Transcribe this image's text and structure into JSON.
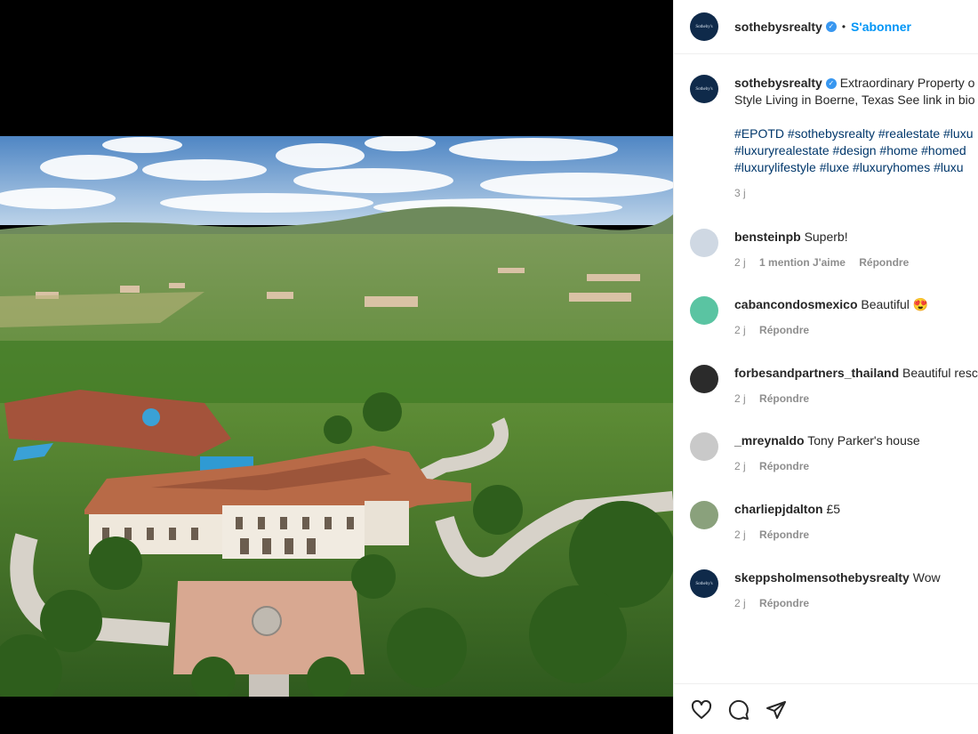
{
  "post": {
    "username": "sothebysrealty",
    "follow_label": "S'abonner",
    "separator": "•",
    "avatar_text": "Sotheby's"
  },
  "caption": {
    "username": "sothebysrealty",
    "line1": "Extraordinary Property o",
    "line2": "Style Living in Boerne, Texas See link in bio",
    "tags1": "#EPOTD #sothebysrealty #realestate #luxu",
    "tags2": "#luxuryrealestate #design #home #homed",
    "tags3": "#luxurylifestyle #luxe #luxuryhomes #luxu",
    "time": "3 j"
  },
  "comments": [
    {
      "user": "bensteinpb",
      "text": "Superb!",
      "time": "2 j",
      "likes": "1 mention J'aime",
      "reply": "Répondre"
    },
    {
      "user": "cabancondosmexico",
      "text": "Beautiful 😍",
      "time": "2 j",
      "reply": "Répondre"
    },
    {
      "user": "forbesandpartners_thailand",
      "text": "Beautiful resc",
      "time": "2 j",
      "reply": "Répondre"
    },
    {
      "user": "_mreynaldo",
      "text": "Tony Parker's house",
      "time": "2 j",
      "reply": "Répondre"
    },
    {
      "user": "charliepjdalton",
      "text": "£5",
      "time": "2 j",
      "reply": "Répondre"
    },
    {
      "user": "skeppsholmensothebysrealty",
      "text": "Wow",
      "time": "2 j",
      "reply": "Répondre"
    }
  ],
  "icons": {
    "like": "heart-icon",
    "comment": "comment-icon",
    "share": "send-icon"
  }
}
